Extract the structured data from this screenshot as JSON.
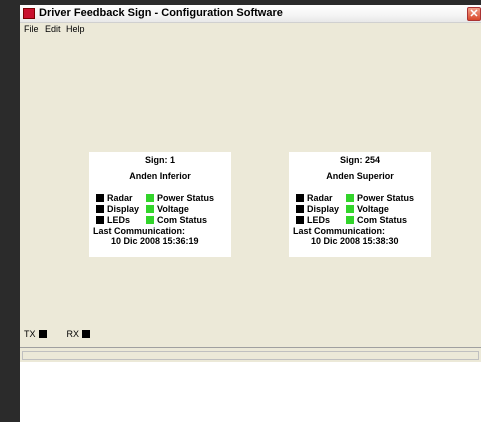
{
  "window": {
    "title": "Driver Feedback Sign - Configuration Software",
    "close_glyph": "✕"
  },
  "menu": {
    "items": [
      "File",
      "Edit",
      "Help"
    ]
  },
  "signs": [
    {
      "sign_label": "Sign: 1",
      "name": "Anden Inferior",
      "status": [
        {
          "label": "Radar",
          "color": "#000000"
        },
        {
          "label": "Power Status",
          "color": "#32d42a"
        },
        {
          "label": "Display",
          "color": "#000000"
        },
        {
          "label": "Voltage",
          "color": "#32d42a"
        },
        {
          "label": "LEDs",
          "color": "#000000"
        },
        {
          "label": "Com Status",
          "color": "#32d42a"
        }
      ],
      "last_comm_label": "Last Communication:",
      "last_comm_time": "10 Dic 2008 15:36:19"
    },
    {
      "sign_label": "Sign: 254",
      "name": "Anden Superior",
      "status": [
        {
          "label": "Radar",
          "color": "#000000"
        },
        {
          "label": "Power Status",
          "color": "#32d42a"
        },
        {
          "label": "Display",
          "color": "#000000"
        },
        {
          "label": "Voltage",
          "color": "#32d42a"
        },
        {
          "label": "LEDs",
          "color": "#000000"
        },
        {
          "label": "Com Status",
          "color": "#32d42a"
        }
      ],
      "last_comm_label": "Last Communication:",
      "last_comm_time": "10 Dic 2008 15:38:30"
    }
  ],
  "indicators": {
    "tx_label": "TX",
    "rx_label": "RX"
  }
}
